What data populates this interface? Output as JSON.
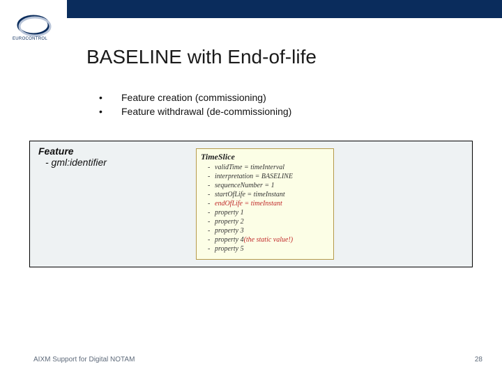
{
  "header": {
    "logo_text": "EUROCONTROL"
  },
  "title": "BASELINE with End-of-life",
  "bullets": [
    "Feature creation (commissioning)",
    "Feature withdrawal (de-commissioning)"
  ],
  "feature_box": {
    "title": "Feature",
    "sub": "- gml:identifier"
  },
  "timeslice": {
    "title": "TimeSlice",
    "rows": [
      {
        "text": "validTime = timeInterval",
        "red": false
      },
      {
        "text": "interpretation = BASELINE",
        "red": false
      },
      {
        "text": "sequenceNumber = 1",
        "red": false
      },
      {
        "text": "startOfLife = timeInstant",
        "red": false
      },
      {
        "text": "endOfLife = timeInstant",
        "red": true
      },
      {
        "text": "property 1",
        "red": false
      },
      {
        "text": "property 2",
        "red": false
      },
      {
        "text": "property 3",
        "red": false
      },
      {
        "text": "property 4 ",
        "red": false,
        "suffix_red": "(the static value!)"
      },
      {
        "text": "property 5",
        "red": false
      }
    ]
  },
  "footer": {
    "left": "AIXM Support for Digital NOTAM",
    "right": "28"
  }
}
